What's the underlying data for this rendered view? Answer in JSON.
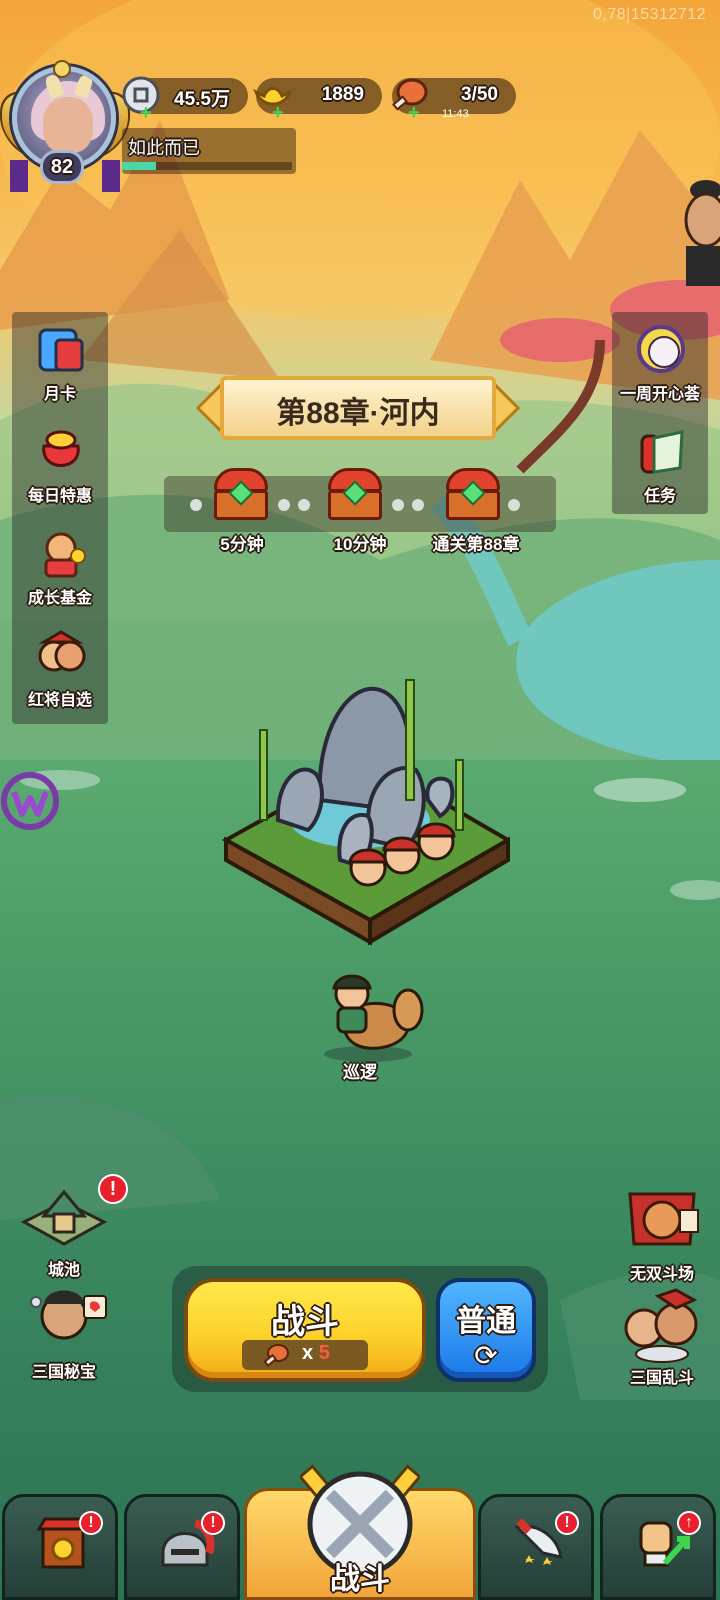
{
  "debug_text": "0,78|15312712",
  "player": {
    "level": "82",
    "name": "如此而已",
    "exp_fraction": 0.2
  },
  "resources": {
    "silver": "45.5万",
    "gold": "1889",
    "stamina": "3/50",
    "stamina_timer": "11:43"
  },
  "left_menu": [
    {
      "label": "月卡",
      "icon": "monthly-card-icon"
    },
    {
      "label": "每日特惠",
      "icon": "daily-deal-gift-bag-icon"
    },
    {
      "label": "成长基金",
      "icon": "growth-fund-icon"
    },
    {
      "label": "红将自选",
      "icon": "red-general-select-icon"
    }
  ],
  "right_menu": [
    {
      "label": "一周开心荟",
      "icon": "weekly-event-icon"
    },
    {
      "label": "任务",
      "icon": "quest-scroll-icon"
    }
  ],
  "chapter": {
    "title": "第88章·河内"
  },
  "chests": [
    {
      "label": "5分钟"
    },
    {
      "label": "10分钟"
    },
    {
      "label": "通关第88章"
    }
  ],
  "patrol_label": "巡逻",
  "corner_left": [
    {
      "label": "城池",
      "alert": "!"
    },
    {
      "label": "三国秘宝"
    }
  ],
  "corner_right": [
    {
      "label": "无双斗场"
    },
    {
      "label": "三国乱斗"
    }
  ],
  "battle": {
    "label": "战斗",
    "cost_prefix": "x",
    "cost_value": "5",
    "mode_label": "普通",
    "refresh_symbol": "⟳"
  },
  "bottom_nav": {
    "center_label": "战斗",
    "tabs": [
      {
        "name": "shop",
        "alert": "!"
      },
      {
        "name": "heroes",
        "alert": "!"
      },
      {
        "name": "formation",
        "alert": "!"
      },
      {
        "name": "upgrade",
        "alert": "↑"
      }
    ]
  },
  "colors": {
    "accent_yellow": "#fcd22a",
    "accent_blue": "#1a78e8",
    "alert_red": "#e81f2c",
    "exp_green": "#49d7a5"
  }
}
